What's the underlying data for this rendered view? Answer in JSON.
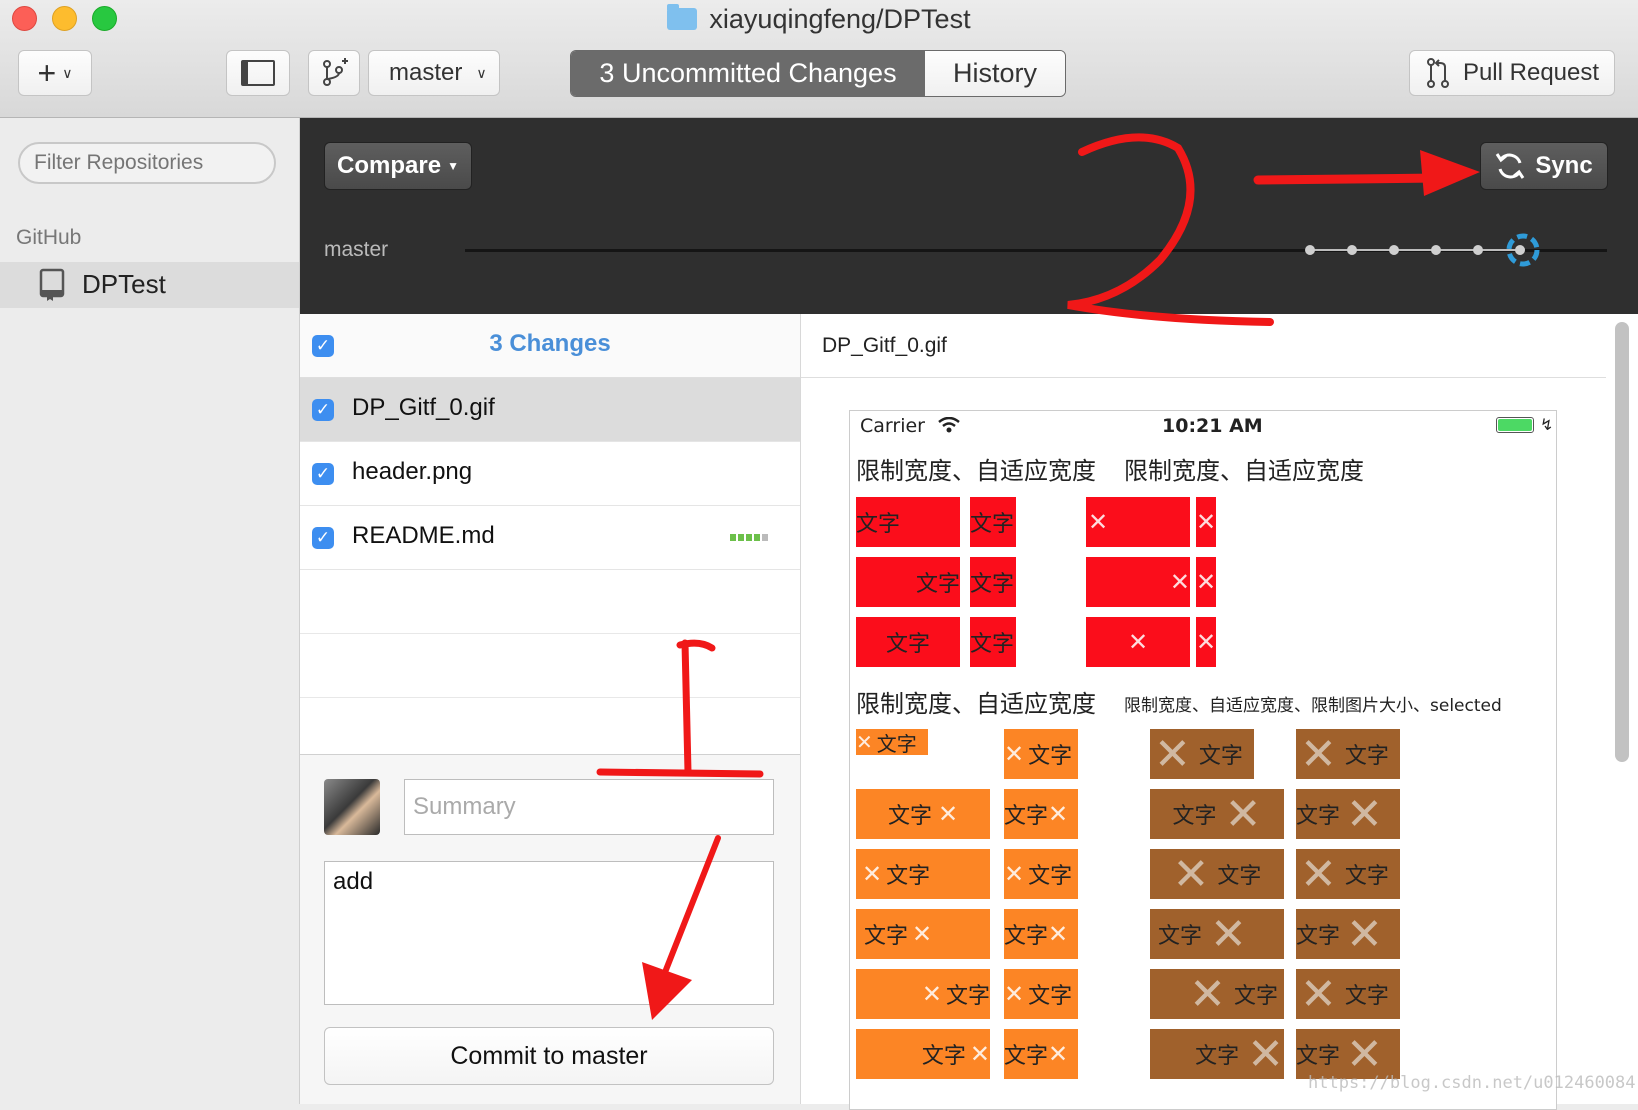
{
  "window": {
    "title": "xiayuqingfeng/DPTest"
  },
  "toolbar": {
    "branch": "master",
    "tab_changes": "3 Uncommitted Changes",
    "tab_history": "History",
    "pull_request": "Pull Request"
  },
  "sidebar": {
    "filter_placeholder": "Filter Repositories",
    "section_label": "GitHub",
    "repo_name": "DPTest"
  },
  "header": {
    "compare_label": "Compare",
    "sync_label": "Sync",
    "branch_label": "master",
    "timeline_commits": 6
  },
  "changes": {
    "count_label": "3 Changes",
    "files": [
      {
        "name": "DP_Gitf_0.gif",
        "checked": true,
        "selected": true
      },
      {
        "name": "header.png",
        "checked": true,
        "selected": false
      },
      {
        "name": "README.md",
        "checked": true,
        "selected": false
      }
    ]
  },
  "commit": {
    "summary_placeholder": "Summary",
    "description": "add",
    "button_label": "Commit to master"
  },
  "diff": {
    "file_name": "DP_Gitf_0.gif",
    "preview": {
      "carrier": "Carrier",
      "time": "10:21 AM",
      "heading_a": "限制宽度、自适应宽度",
      "heading_b": "限制宽度、自适应宽度",
      "heading_c": "限制宽度、自适应宽度",
      "heading_d": "限制宽度、自适应宽度、限制图片大小、selected",
      "tag_text": "文字",
      "x_glyph": "✕"
    }
  },
  "annotations": {
    "label_1": "1",
    "label_2": "2",
    "color": "#f01818"
  },
  "watermark": "https://blog.csdn.net/u012460084",
  "colors": {
    "accent": "#3d8ef0",
    "link": "#4a8fd8",
    "sync_ring": "#2f9bd8",
    "red_tag": "#fb0d1b",
    "orange_tag": "#fc8525",
    "brown_tag": "#a0612c"
  }
}
